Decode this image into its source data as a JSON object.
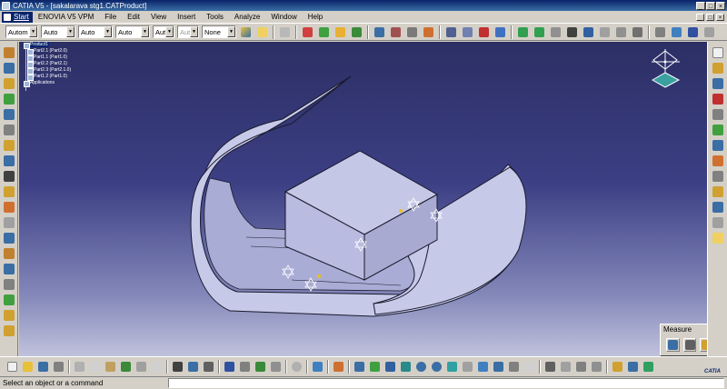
{
  "window": {
    "title": "CATIA V5 - [sakalarava stg1.CATProduct]",
    "controls": [
      "_",
      "□",
      "×"
    ]
  },
  "menubar": {
    "start_label": "Start",
    "items": [
      "ENOVIA V5 VPM",
      "File",
      "Edit",
      "View",
      "Insert",
      "Tools",
      "Analyze",
      "Window",
      "Help"
    ],
    "doc_controls": [
      "_",
      "□",
      "×"
    ]
  },
  "toolbar_top": {
    "combos": [
      {
        "value": "Autom",
        "disabled": false
      },
      {
        "value": "Auto",
        "disabled": false
      },
      {
        "value": "Auto",
        "disabled": false
      },
      {
        "value": "Auto",
        "disabled": false
      },
      {
        "value": "Aut",
        "disabled": false
      },
      {
        "value": "Aut",
        "disabled": true
      },
      {
        "value": "None",
        "disabled": false
      }
    ]
  },
  "tree": {
    "root": "Product1",
    "items": [
      "Part2.1 (Part2.0)",
      "Part1.1 (Part1.0)",
      "Part2.2 (Part2.1)",
      "Part2.3 (Part2.1.0)",
      "Part1.2 (Part1.0)"
    ],
    "footer": "Applications"
  },
  "measure_panel": {
    "title": "Measure",
    "close": "×"
  },
  "status": {
    "prompt": "Select an object or a command"
  },
  "logo": {
    "text": "CATIA"
  },
  "colors": {
    "titlebar": "#0a246a",
    "viewport_top": "#2c2f64",
    "viewport_bottom": "#c0c2dc",
    "part_face": "#c7c9e8",
    "part_edge": "#1a1a2e",
    "constraint": "#ffffff"
  }
}
